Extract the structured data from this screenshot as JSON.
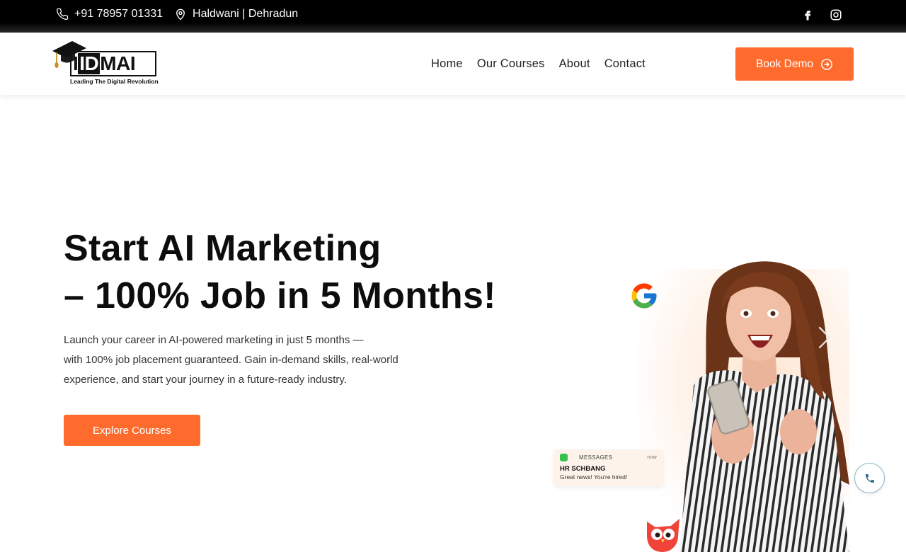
{
  "topbar": {
    "phone": "+91 78957 01331",
    "location": "Haldwani | Dehradun",
    "icons": [
      "phone-icon",
      "location-pin-icon",
      "facebook-icon",
      "instagram-icon"
    ]
  },
  "logo": {
    "name": "IIDMAI",
    "tagline": "Leading The Digital Revolution"
  },
  "nav": {
    "items": [
      "Home",
      "Our Courses",
      "About",
      "Contact"
    ]
  },
  "cta": {
    "book_demo": "Book Demo"
  },
  "hero": {
    "title_line1": "Start AI Marketing",
    "title_line2": "– 100% Job in 5 Months!",
    "description_line1": "Launch your career in AI-powered marketing in just 5 months —",
    "description_line2": "with 100% job placement guaranteed. Gain in-demand skills, real-world",
    "description_line3": "experience, and start your journey in a future-ready industry.",
    "button": "Explore Courses"
  },
  "notification": {
    "app": "MESSAGES",
    "time": "now",
    "from": "HR SCHBANG",
    "text": "Great news! You're hired!"
  },
  "colors": {
    "accent": "#ff6b2c",
    "topbar": "#000000",
    "text": "#0d0d0d"
  }
}
